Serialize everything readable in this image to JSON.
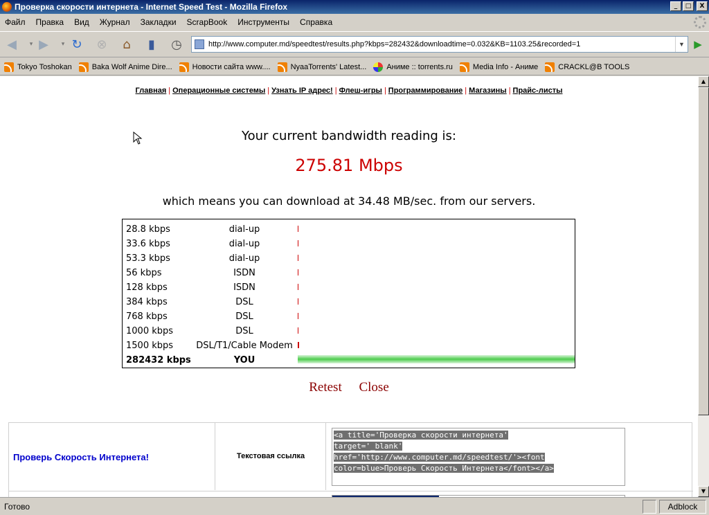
{
  "window": {
    "title": "Проверка скорости интернета - Internet Speed Test - Mozilla Firefox",
    "controls": {
      "minimize": "_",
      "maximize": "□",
      "close": "X"
    }
  },
  "menu": [
    "Файл",
    "Правка",
    "Вид",
    "Журнал",
    "Закладки",
    "ScrapBook",
    "Инструменты",
    "Справка"
  ],
  "nav": {
    "url": "http://www.computer.md/speedtest/results.php?kbps=282432&downloadtime=0.032&KB=1103.25&recorded=1",
    "icons": [
      "back-icon",
      "forward-icon",
      "reload-icon",
      "stop-icon",
      "home-icon",
      "bookmarks-icon",
      "history-icon"
    ]
  },
  "bookmarks": [
    {
      "label": "Tokyo Toshokan",
      "icon": "rss-icon"
    },
    {
      "label": "Baka Wolf Anime Dire...",
      "icon": "rss-icon"
    },
    {
      "label": "Новости сайта www....",
      "icon": "rss-icon"
    },
    {
      "label": "NyaaTorrents' Latest...",
      "icon": "rss-icon"
    },
    {
      "label": "Аниме :: torrents.ru",
      "icon": "torrent-icon"
    },
    {
      "label": "Media Info - Аниме",
      "icon": "rss-icon"
    },
    {
      "label": "CRACKL@B TOOLS",
      "icon": "rss-icon"
    }
  ],
  "page": {
    "toplinks": [
      "Главная",
      "Операционные системы",
      "Узнать IP адрес!",
      "Флеш-игры",
      "Программирование",
      "Магазины",
      "Прайс-листы"
    ],
    "heading": "Your current bandwidth reading is:",
    "speed": "275.81 Mbps",
    "means": "which means you can download at 34.48 MB/sec. from our servers.",
    "rows": [
      {
        "rate": "28.8 kbps",
        "type": "dial-up",
        "bar_fraction": 0.0001
      },
      {
        "rate": "33.6 kbps",
        "type": "dial-up",
        "bar_fraction": 0.0001
      },
      {
        "rate": "53.3 kbps",
        "type": "dial-up",
        "bar_fraction": 0.0002
      },
      {
        "rate": "56 kbps",
        "type": "ISDN",
        "bar_fraction": 0.0002
      },
      {
        "rate": "128 kbps",
        "type": "ISDN",
        "bar_fraction": 0.0005
      },
      {
        "rate": "384 kbps",
        "type": "DSL",
        "bar_fraction": 0.0014
      },
      {
        "rate": "768 kbps",
        "type": "DSL",
        "bar_fraction": 0.0027
      },
      {
        "rate": "1000 kbps",
        "type": "DSL",
        "bar_fraction": 0.0035
      },
      {
        "rate": "1500 kbps",
        "type": "DSL/T1/Cable Modem",
        "bar_fraction": 0.0053
      },
      {
        "rate": "282432 kbps",
        "type": "YOU",
        "bar_fraction": 1.0
      }
    ],
    "retest": "Retest",
    "close": "Close",
    "link_preview": "Проверь Скорость Интернета!",
    "link_type": "Текстовая ссылка",
    "code_lines": [
      "<a title='Проверка скорости интернета'",
      "target='_blank'",
      "href='http://www.computer.md/speedtest/'><font",
      "color=blue>Проверь Скорость Интернета</font></a>"
    ]
  },
  "status": {
    "text": "Готово",
    "adblock": "Adblock"
  },
  "colors": {
    "speed": "#cc0000",
    "link": "#0000cc",
    "actions": "#8b0000",
    "you_bar": "#4ccc4c"
  }
}
